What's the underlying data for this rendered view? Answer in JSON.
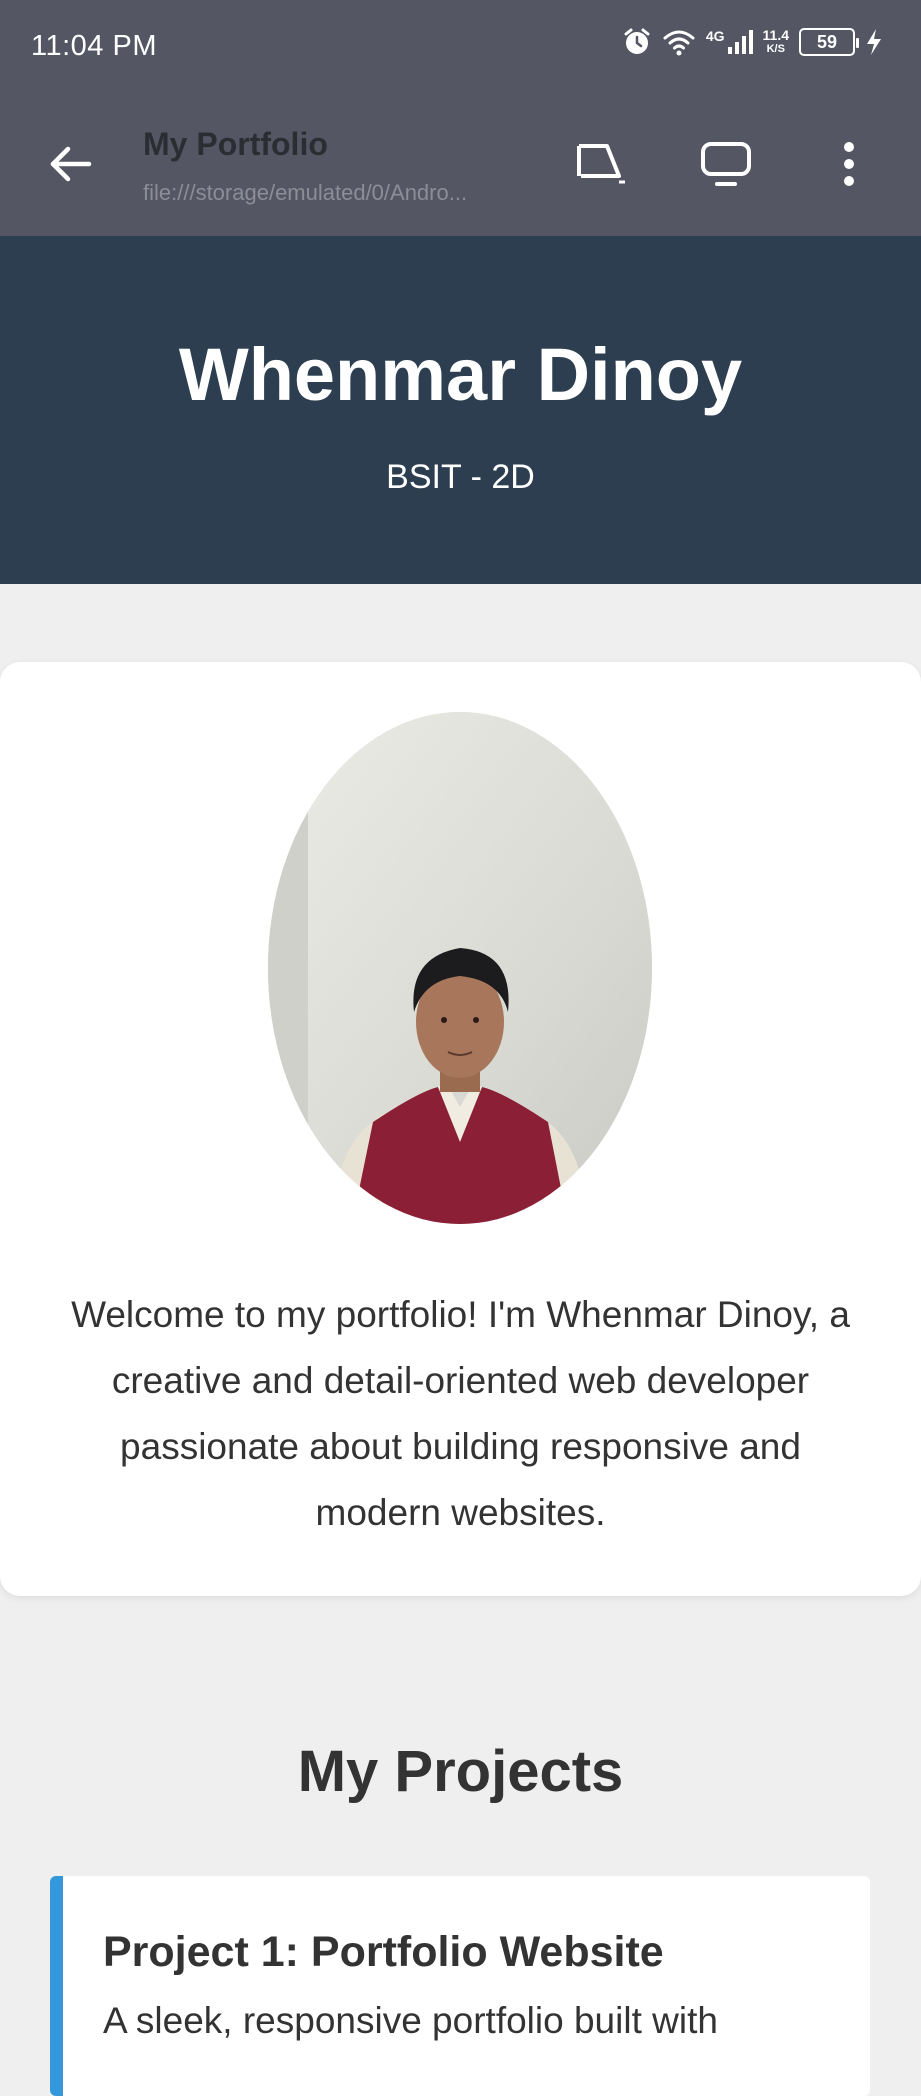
{
  "status_bar": {
    "time": "11:04 PM",
    "network": "4G",
    "speed_value": "11.4",
    "speed_unit": "K/S",
    "battery": "59"
  },
  "app_bar": {
    "title": "My Portfolio",
    "url": "file:///storage/emulated/0/Andro..."
  },
  "header": {
    "name": "Whenmar Dinoy",
    "subtitle": "BSIT - 2D"
  },
  "about": {
    "text": "Welcome to my portfolio! I'm Whenmar Dinoy, a creative and detail-oriented web developer passionate about building responsive and modern websites."
  },
  "projects": {
    "heading": "My Projects",
    "items": [
      {
        "title": "Project 1: Portfolio Website",
        "description": "A sleek, responsive portfolio built with"
      }
    ]
  },
  "colors": {
    "status_bar_bg": "#545763",
    "header_bg": "#2c3e50",
    "accent": "#3498db",
    "page_bg": "#efefef"
  }
}
